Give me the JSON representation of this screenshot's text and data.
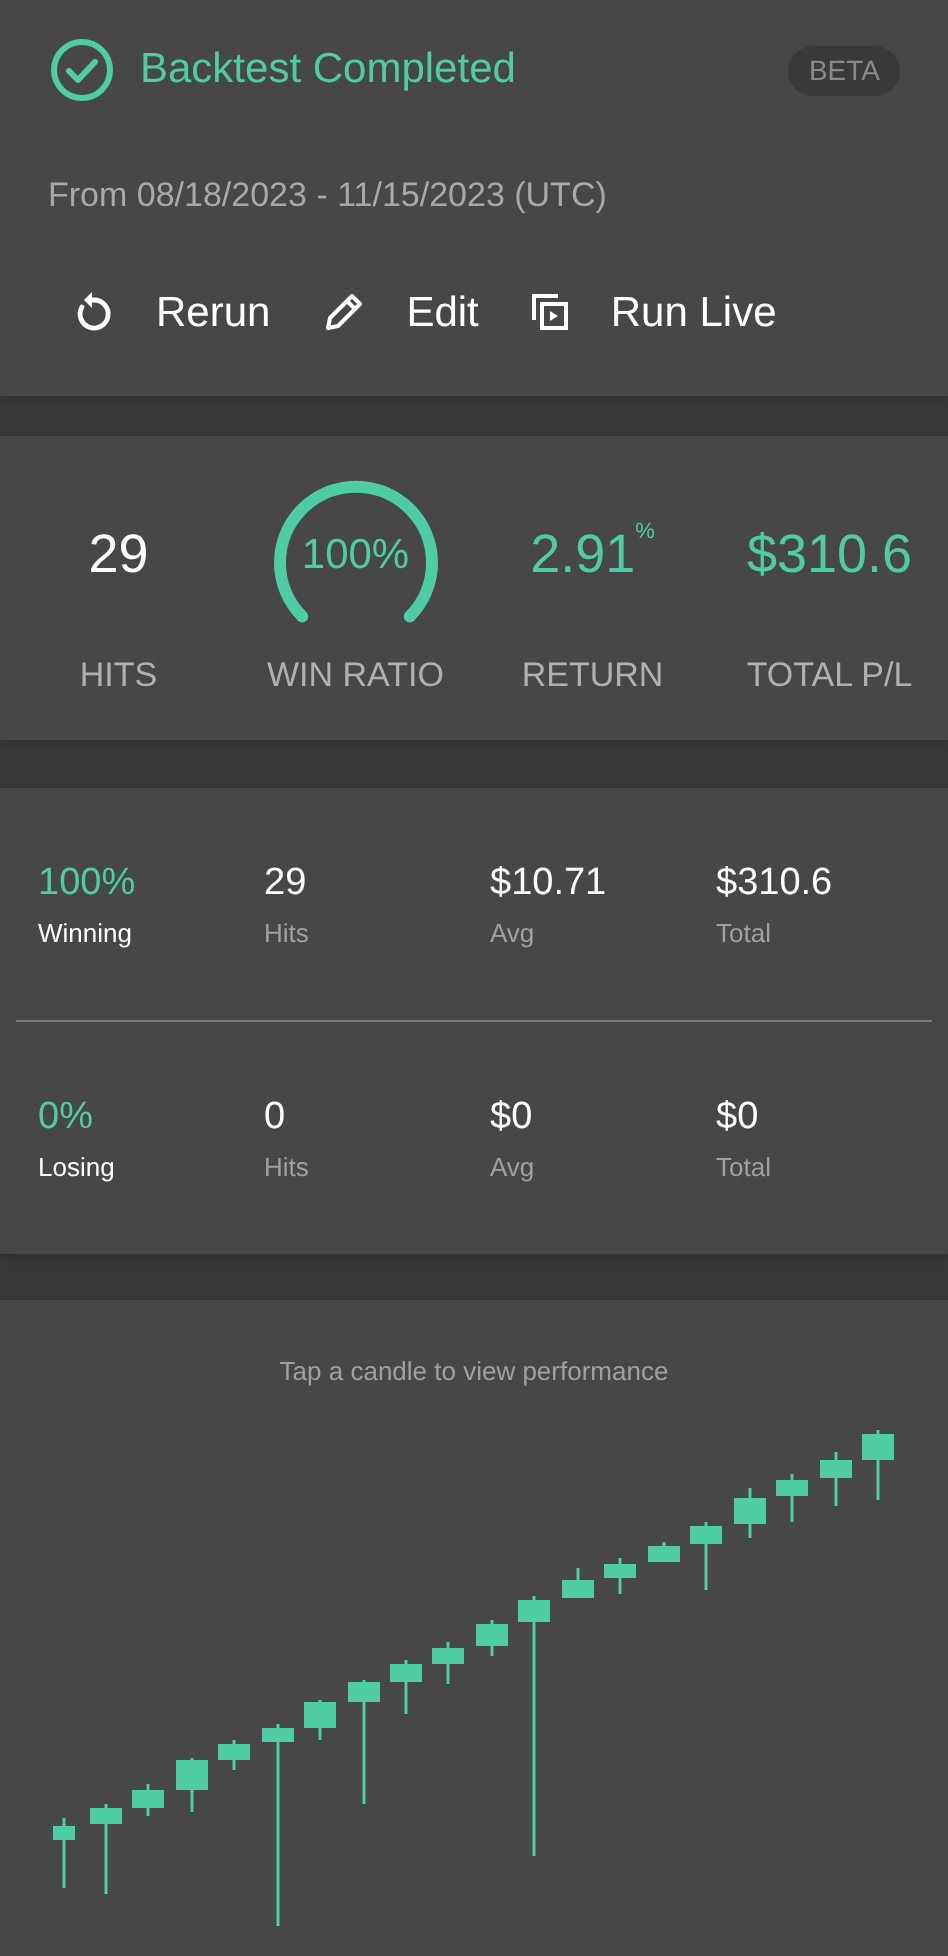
{
  "header": {
    "status": "Backtest Completed",
    "badge": "BETA",
    "date_range": "From 08/18/2023 - 11/15/2023 (UTC)",
    "actions": [
      {
        "kind": "rerun",
        "label": "Rerun"
      },
      {
        "kind": "edit",
        "label": "Edit"
      },
      {
        "kind": "live",
        "label": "Run Live"
      }
    ]
  },
  "summary": [
    {
      "kind": "count",
      "value": "29",
      "label": "HITS"
    },
    {
      "kind": "gauge",
      "value": "100%",
      "label": "WIN RATIO"
    },
    {
      "kind": "gain",
      "value": "2.91$^{%}$",
      "label": "RETURN"
    },
    {
      "kind": "gain",
      "value": "$310.6",
      "label": "TOTAL P/L"
    }
  ],
  "breakdown": [
    {
      "percent": "100%",
      "label": "Winning",
      "cells": [
        {
          "value": "29",
          "label": "Hits"
        },
        {
          "value": "$10.71",
          "label": "Avg"
        },
        {
          "value": "$310.6",
          "label": "Total"
        }
      ]
    },
    {
      "percent": "0%",
      "label": "Losing",
      "cells": [
        {
          "value": "0",
          "label": "Hits"
        },
        {
          "value": "$0",
          "label": "Avg"
        },
        {
          "value": "$0",
          "label": "Total"
        }
      ]
    }
  ],
  "chart": {
    "hint": "Tap a candle to view performance"
  }
}
